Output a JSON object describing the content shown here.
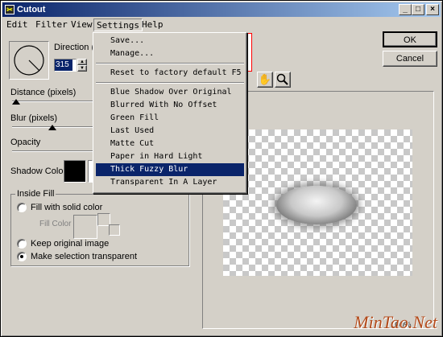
{
  "window": {
    "title": "Cutout",
    "minimize_glyph": "_",
    "maximize_glyph": "□",
    "close_glyph": "×"
  },
  "menubar": {
    "items": [
      "Edit",
      "Filter",
      "View",
      "Settings",
      "Help"
    ]
  },
  "settings_menu": {
    "items": [
      "Save...",
      "Manage...",
      "Reset to factory default F5",
      "Blue Shadow Over Original",
      "Blurred With No Offset",
      "Green Fill",
      "Last Used",
      "Matte Cut",
      "Paper in Hard Light",
      "Thick Fuzzy Blur",
      "Transparent In A Layer"
    ],
    "selected": "Thick Fuzzy Blur"
  },
  "controls": {
    "direction_label": "Direction (",
    "direction_value": "315",
    "distance_label": "Distance (pixels)",
    "distance_level": 0.05,
    "blur_label": "Blur (pixels)",
    "blur_level": 0.5,
    "opacity_label": "Opacity",
    "shadow_color_label": "Shadow Color",
    "shadow_color": "#000000"
  },
  "inside_fill": {
    "group_label": "Inside Fill",
    "fill_solid_label": "Fill with solid color",
    "fill_color_label": "Fill Color",
    "keep_original_label": "Keep original image",
    "make_transparent_label": "Make selection transparent",
    "selected_option": "Make selection transparent"
  },
  "buttons": {
    "ok": "OK",
    "cancel": "Cancel"
  },
  "preview": {
    "zoom_label": "100%",
    "tools": [
      "hand-icon",
      "zoom-icon"
    ]
  },
  "watermark": "MinTao.Net"
}
